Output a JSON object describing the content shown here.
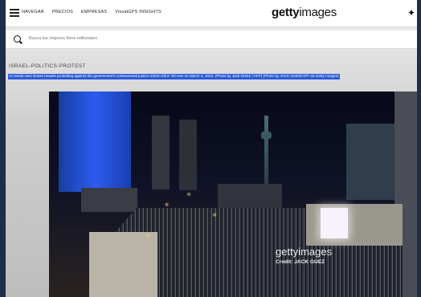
{
  "header": {
    "nav_items": [
      "NAVEGAR",
      "PRECIOS",
      "EMPRESAS",
      "VisualGPS INSIGHTS"
    ],
    "logo_bold": "getty",
    "logo_light": "images",
    "sparkle_icon": "sparkle-icon"
  },
  "search": {
    "placeholder": "Busca las mejores fotos editoriales"
  },
  "image": {
    "title": "ISRAEL-POLITICS-PROTEST",
    "caption": "An aerial view shows Israelis protesting against the government's controversial justice reform bill in Tel Aviv on March 4, 2023. (Photo by Jack GUEZ / AFP) (Photo by JACK GUEZ/AFP via Getty Images)",
    "watermark": "gettyimages",
    "credit": "Credit: JACK GUEZ"
  }
}
